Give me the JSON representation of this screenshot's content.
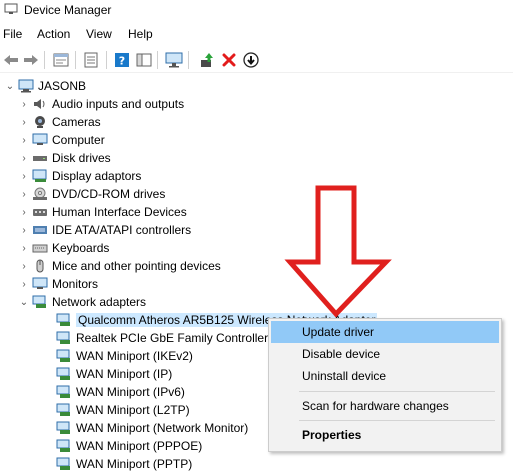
{
  "window": {
    "title": "Device Manager"
  },
  "menu": [
    "File",
    "Action",
    "View",
    "Help"
  ],
  "toolbar": {
    "buttons": [
      "back-icon",
      "forward-icon",
      "properties-sheet-icon",
      "list-icon",
      "help-icon",
      "panel-icon",
      "monitor-scan-icon",
      "update-driver-icon",
      "uninstall-icon",
      "disable-icon"
    ],
    "accent": "#1979ca",
    "remove_color": "#e31b1b"
  },
  "tree": {
    "root": "JASONB",
    "categories": [
      "Audio inputs and outputs",
      "Cameras",
      "Computer",
      "Disk drives",
      "Display adaptors",
      "DVD/CD-ROM drives",
      "Human Interface Devices",
      "IDE ATA/ATAPI controllers",
      "Keyboards",
      "Mice and other pointing devices",
      "Monitors",
      "Network adapters"
    ],
    "network_children": [
      "Qualcomm Atheros AR5B125 Wireless Network Adapter",
      "Realtek PCIe GbE Family Controller",
      "WAN Miniport (IKEv2)",
      "WAN Miniport (IP)",
      "WAN Miniport (IPv6)",
      "WAN Miniport (L2TP)",
      "WAN Miniport (Network Monitor)",
      "WAN Miniport (PPPOE)",
      "WAN Miniport (PPTP)"
    ]
  },
  "context_menu": {
    "items": [
      "Update driver",
      "Disable device",
      "Uninstall device",
      "Scan for hardware changes",
      "Properties"
    ],
    "highlight_color": "#91c9f7"
  },
  "annotation": {
    "arrow_color": "#e0201e"
  }
}
